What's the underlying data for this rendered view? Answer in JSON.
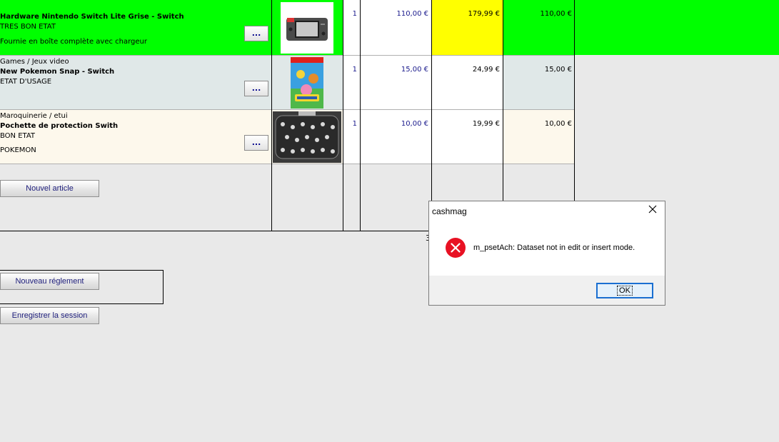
{
  "rows": [
    {
      "category": "",
      "name": "Hardware Nintendo Switch Lite Grise - Switch",
      "condition": "TRES BON ETAT",
      "note": "Fournie en boîte complète avec chargeur",
      "qty": "1",
      "purchase_price": "110,00 €",
      "sale_price": "179,99 €",
      "total": "110,00 €",
      "more_label": "...",
      "thumbnail_icon": "nintendo-switch-lite-box-icon"
    },
    {
      "category": "Games / Jeux video",
      "name": "New Pokemon Snap - Switch",
      "condition": "ETAT D'USAGE",
      "note": "",
      "qty": "1",
      "purchase_price": "15,00 €",
      "sale_price": "24,99 €",
      "total": "15,00 €",
      "more_label": "...",
      "thumbnail_icon": "pokemon-snap-cover-icon"
    },
    {
      "category": "Maroquinerie / etui",
      "name": "Pochette de protection Swith",
      "condition": "BON ETAT",
      "note": "POKEMON",
      "qty": "1",
      "purchase_price": "10,00 €",
      "sale_price": "19,99 €",
      "total": "10,00 €",
      "more_label": "...",
      "thumbnail_icon": "pokemon-pouch-icon"
    }
  ],
  "buttons": {
    "new_article": "Nouvel article",
    "new_payment": "Nouveau réglement",
    "save_session": "Enregistrer la session"
  },
  "partial_text": "3",
  "dialog": {
    "title": "cashmag",
    "message": "m_psetAch: Dataset not in edit or insert mode.",
    "ok_label": "OK",
    "error_icon": "error-x-icon",
    "close_icon": "close-icon"
  },
  "colors": {
    "highlight_row": "#00ff00",
    "sale_price_highlight": "#ffff00",
    "row_alt": "#e0e8e8",
    "row_cream": "#fdf8ec",
    "error_red": "#e81123"
  }
}
